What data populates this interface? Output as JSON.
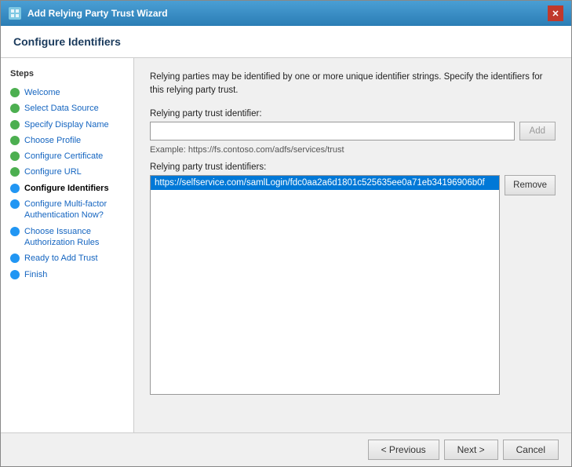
{
  "dialog": {
    "title": "Add Relying Party Trust Wizard",
    "close_label": "✕"
  },
  "page_header": {
    "title": "Configure Identifiers"
  },
  "sidebar": {
    "steps_label": "Steps",
    "items": [
      {
        "id": "welcome",
        "label": "Welcome",
        "dot": "green",
        "active": false
      },
      {
        "id": "select-data-source",
        "label": "Select Data Source",
        "dot": "green",
        "active": false
      },
      {
        "id": "specify-display-name",
        "label": "Specify Display Name",
        "dot": "green",
        "active": false
      },
      {
        "id": "choose-profile",
        "label": "Choose Profile",
        "dot": "green",
        "active": false
      },
      {
        "id": "configure-certificate",
        "label": "Configure Certificate",
        "dot": "green",
        "active": false
      },
      {
        "id": "configure-url",
        "label": "Configure URL",
        "dot": "green",
        "active": false
      },
      {
        "id": "configure-identifiers",
        "label": "Configure Identifiers",
        "dot": "blue",
        "active": true
      },
      {
        "id": "configure-multifactor",
        "label": "Configure Multi-factor Authentication Now?",
        "dot": "blue",
        "active": false
      },
      {
        "id": "choose-issuance",
        "label": "Choose Issuance Authorization Rules",
        "dot": "blue",
        "active": false
      },
      {
        "id": "ready-to-add",
        "label": "Ready to Add Trust",
        "dot": "blue",
        "active": false
      },
      {
        "id": "finish",
        "label": "Finish",
        "dot": "blue",
        "active": false
      }
    ]
  },
  "main": {
    "description": "Relying parties may be identified by one or more unique identifier strings. Specify the identifiers for this relying party trust.",
    "identifier_label": "Relying party trust identifier:",
    "identifier_placeholder": "",
    "add_button": "Add",
    "example_text": "Example: https://fs.contoso.com/adfs/services/trust",
    "identifiers_label": "Relying party trust identifiers:",
    "identifiers": [
      "https://selfservice.com/samlLogin/fdc0aa2a6d1801c525635ee0a71eb34196906b0f"
    ],
    "remove_button": "Remove"
  },
  "footer": {
    "previous_label": "< Previous",
    "next_label": "Next >",
    "cancel_label": "Cancel"
  }
}
